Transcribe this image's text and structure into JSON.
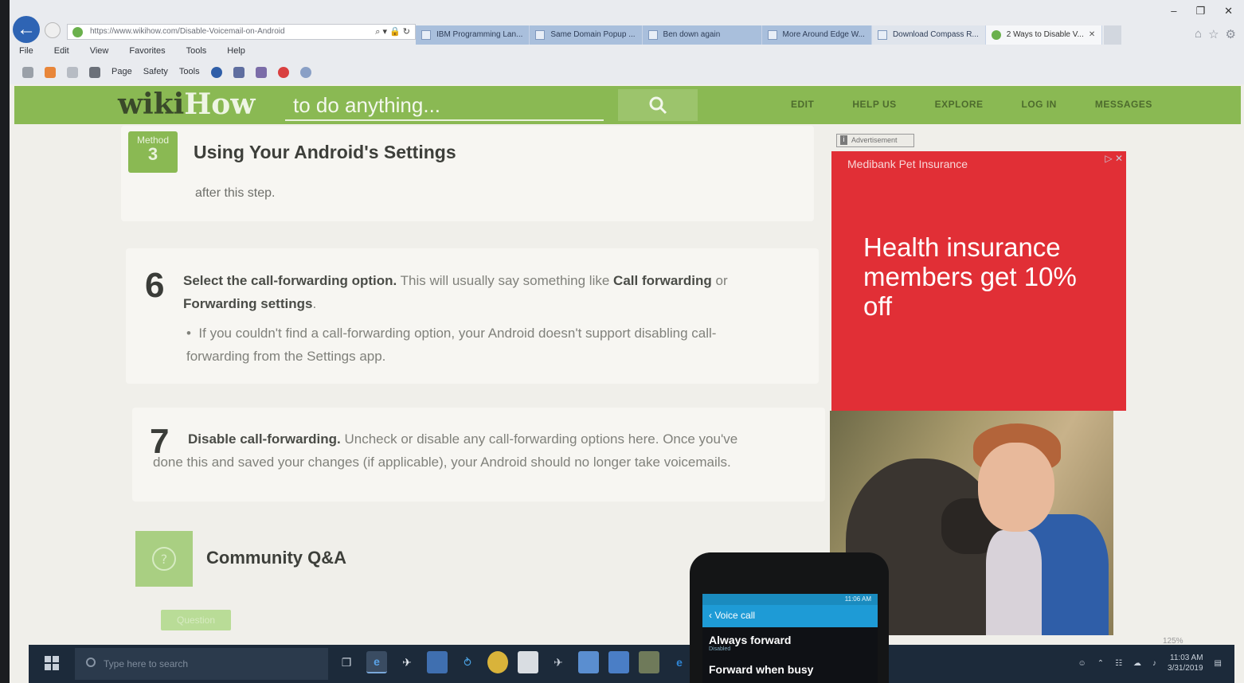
{
  "browser": {
    "url": "https://www.wikihow.com/Disable-Voicemail-on-Android",
    "menu": [
      "File",
      "Edit",
      "View",
      "Favorites",
      "Tools",
      "Help"
    ],
    "command_bar": [
      "Page",
      "Safety",
      "Tools"
    ],
    "tabs": [
      {
        "label": "IBM Programming Lan...",
        "state": "inactive"
      },
      {
        "label": "Same Domain Popup ...",
        "state": "inactive"
      },
      {
        "label": "Ben down again",
        "state": "inactive"
      },
      {
        "label": "More Around Edge W...",
        "state": "inactive"
      },
      {
        "label": "Download Compass R...",
        "state": "light"
      },
      {
        "label": "2 Ways to Disable V...",
        "state": "active"
      }
    ],
    "zoom": "125%"
  },
  "wikihow": {
    "logo_part1": "wiki",
    "logo_part2": "How",
    "search_placeholder": "to do anything...",
    "nav": [
      "EDIT",
      "HELP US",
      "EXPLORE",
      "LOG IN",
      "MESSAGES"
    ]
  },
  "article": {
    "method_label": "Method",
    "method_number": "3",
    "method_title": "Using Your Android's Settings",
    "prev_step_tail": "after this step.",
    "steps": [
      {
        "number": "6",
        "bold": "Select the call-forwarding option.",
        "text_a": " This will usually say something like ",
        "bold2": "Call forwarding",
        "text_b": " or ",
        "bold3": "Forwarding settings",
        "text_c": ".",
        "bullet": "If you couldn't find a call-forwarding option, your Android doesn't support disabling call-forwarding from the Settings app."
      },
      {
        "number": "7",
        "bold": "Disable call-forwarding.",
        "text": " Uncheck or disable any call-forwarding options here. Once you've done this and saved your changes (if applicable), your Android should no longer take voicemails."
      }
    ],
    "qa_title": "Community Q&A",
    "qa_button": "Question"
  },
  "ad": {
    "label": "Advertisement",
    "brand": "Medibank Pet Insurance",
    "headline": "Health insurance members get 10% off",
    "accent": "#e12f36"
  },
  "taskbar": {
    "search_placeholder": "Type here to search",
    "time": "11:03 AM",
    "date": "3/31/2019"
  },
  "phone": {
    "status_time": "11:06 AM",
    "title": "Voice call",
    "items": [
      {
        "label": "Always forward",
        "sub": "Disabled"
      },
      {
        "label": "Forward when busy",
        "sub": ""
      }
    ]
  }
}
